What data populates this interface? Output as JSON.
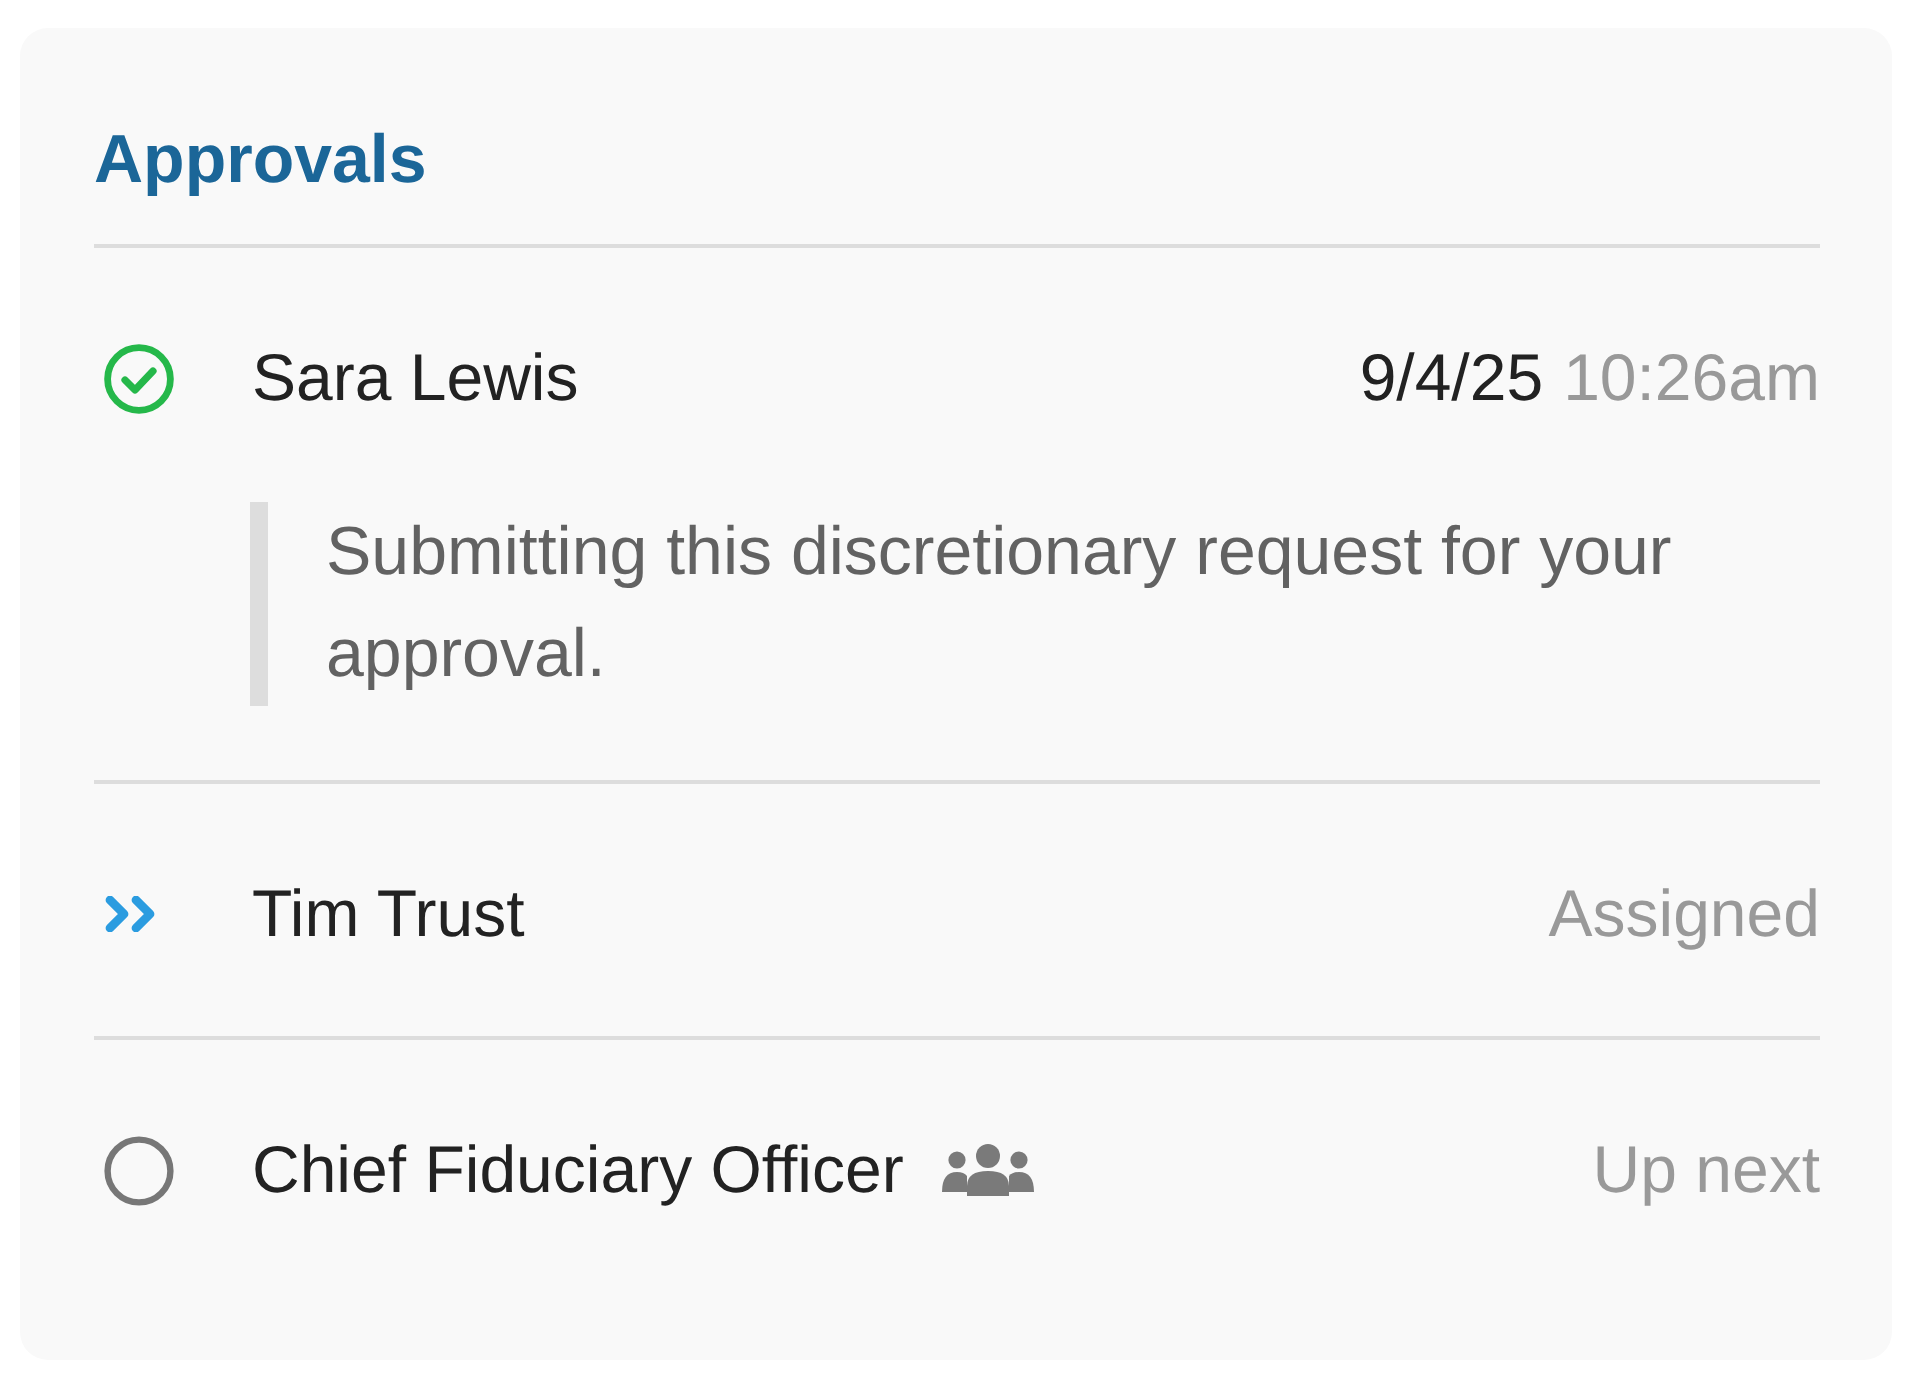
{
  "card": {
    "title": "Approvals"
  },
  "approvals": [
    {
      "kind": "approved",
      "name": "Sara Lewis",
      "group": false,
      "date": "9/4/25",
      "time": "10:26am",
      "comment": "Submitting this discretionary request for your approval."
    },
    {
      "kind": "assigned",
      "name": "Tim Trust",
      "group": false,
      "status_text": "Assigned"
    },
    {
      "kind": "pending",
      "name": "Chief Fiduciary Officer",
      "group": true,
      "status_text": "Up next"
    }
  ]
}
